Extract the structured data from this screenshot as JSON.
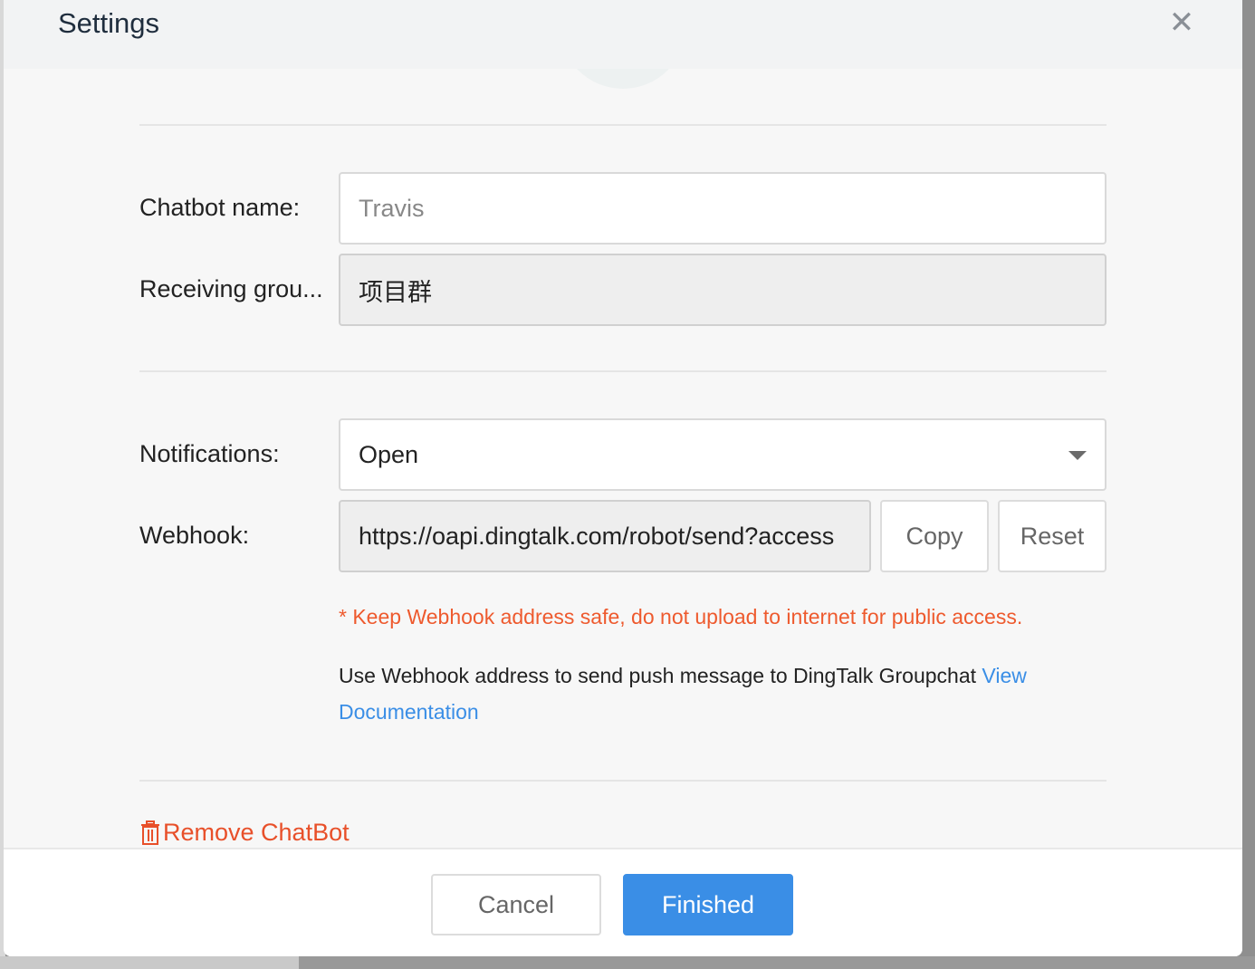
{
  "dialog": {
    "title": "Settings",
    "close_icon": "close-icon"
  },
  "form": {
    "chatbot_name_label": "Chatbot name:",
    "chatbot_name_placeholder": "Travis",
    "receiving_group_label": "Receiving grou...",
    "receiving_group_value": "项目群",
    "notifications_label": "Notifications:",
    "notifications_value": "Open",
    "webhook_label": "Webhook:",
    "webhook_value": "https://oapi.dingtalk.com/robot/send?access",
    "copy_label": "Copy",
    "reset_label": "Reset",
    "warning_text": "* Keep Webhook address safe, do not upload to internet for public access.",
    "help_text": "Use Webhook address to send push message to DingTalk Groupchat",
    "view_link": "View",
    "documentation_link": "Documentation"
  },
  "remove_label": "Remove ChatBot",
  "footer": {
    "cancel_label": "Cancel",
    "finished_label": "Finished"
  },
  "colors": {
    "primary": "#3a8ee6",
    "warning": "#ee5a2e",
    "danger": "#e8502a"
  }
}
